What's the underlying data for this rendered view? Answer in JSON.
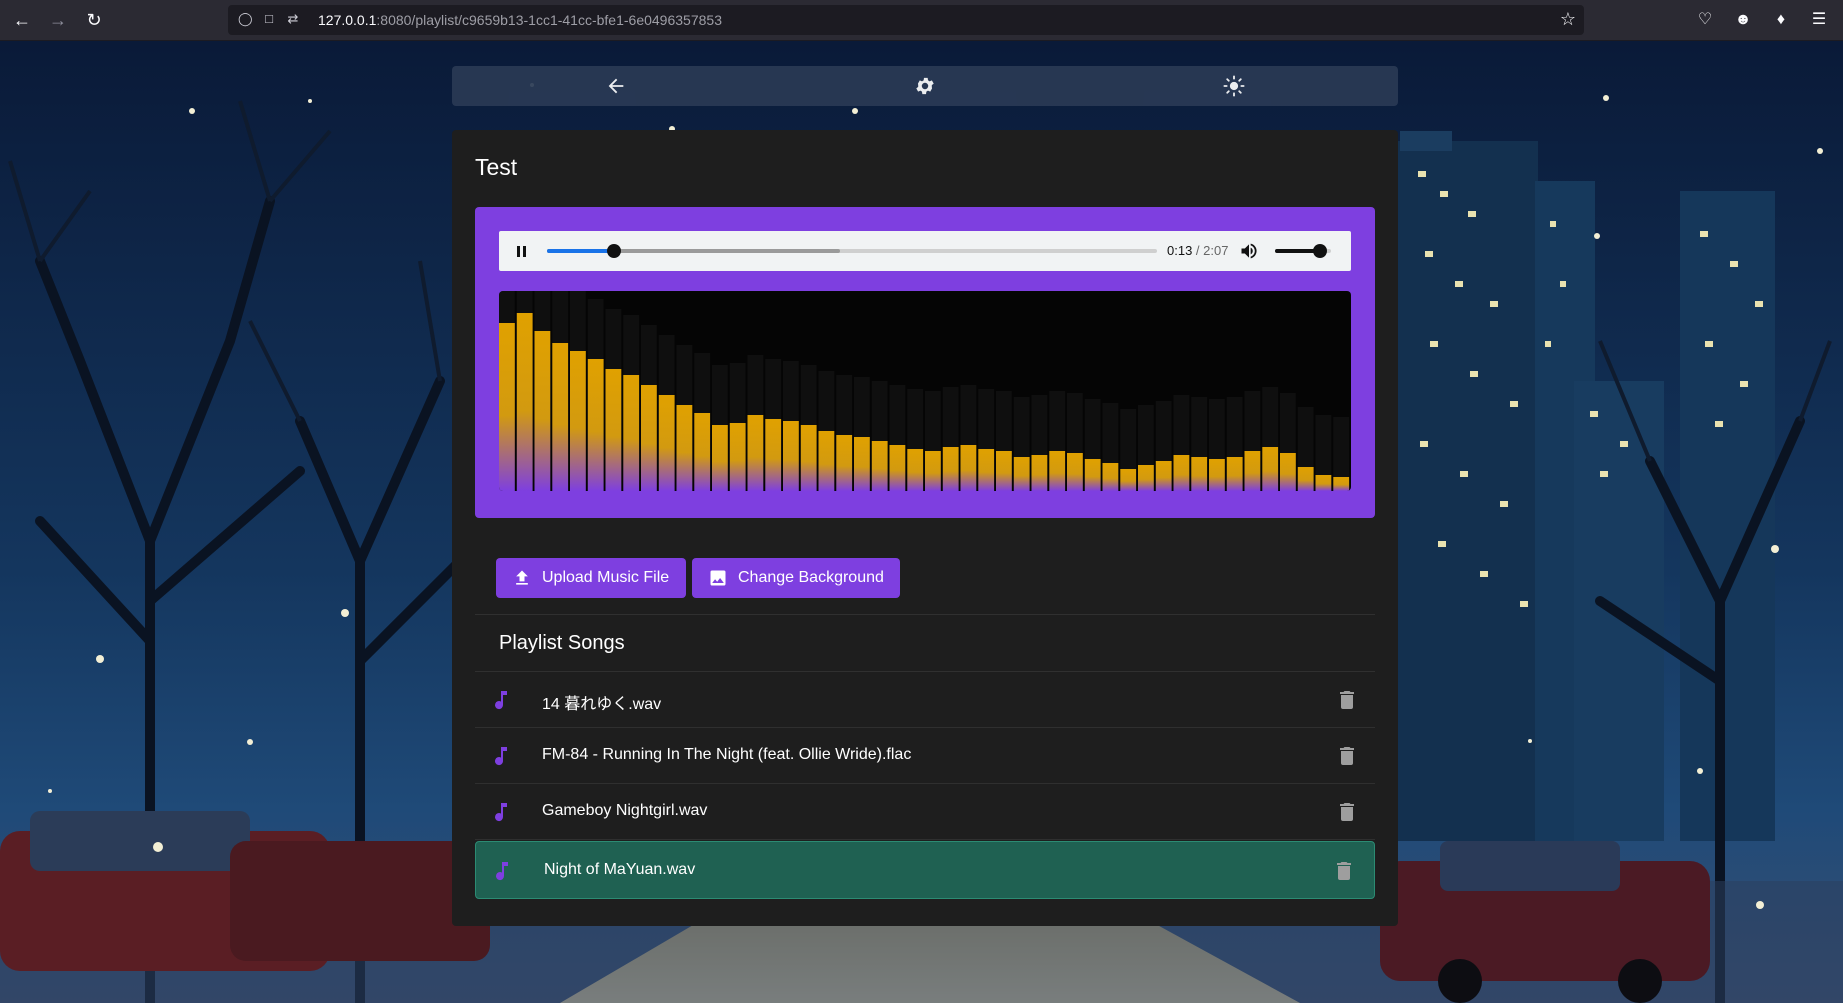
{
  "browser": {
    "url_host": "127.0.0.1",
    "url_rest": ":8080/playlist/c9659b13-1cc1-41cc-bfe1-6e0496357853"
  },
  "nav": {
    "back_icon": "arrow-back-icon",
    "settings_icon": "gear-icon",
    "theme_icon": "sun-icon"
  },
  "page": {
    "title": "Test"
  },
  "player": {
    "current_time": "0:13",
    "separator": " / ",
    "duration": "2:07",
    "progress_fraction": 0.11,
    "buffered_fraction": 0.48,
    "volume_fraction": 0.8,
    "bar_levels": [
      0.84,
      0.89,
      0.8,
      0.74,
      0.7,
      0.66,
      0.61,
      0.58,
      0.53,
      0.48,
      0.43,
      0.39,
      0.33,
      0.34,
      0.38,
      0.36,
      0.35,
      0.33,
      0.3,
      0.28,
      0.27,
      0.25,
      0.23,
      0.21,
      0.2,
      0.22,
      0.23,
      0.21,
      0.2,
      0.17,
      0.18,
      0.2,
      0.19,
      0.16,
      0.14,
      0.11,
      0.13,
      0.15,
      0.18,
      0.17,
      0.16,
      0.17,
      0.2,
      0.22,
      0.19,
      0.12,
      0.08,
      0.07
    ],
    "colors": {
      "bar_top": "#e0a100",
      "bar_bottom": "#7e3fe0",
      "panel": "#7e3fe0"
    }
  },
  "actions": {
    "upload_label": "Upload Music File",
    "background_label": "Change Background"
  },
  "playlist": {
    "heading": "Playlist Songs",
    "songs": [
      {
        "title": "14 暮れゆく.wav"
      },
      {
        "title": "FM-84 - Running In The Night (feat. Ollie Wride).flac"
      },
      {
        "title": "Gameboy Nightgirl.wav"
      },
      {
        "title": "Night of MaYuan.wav",
        "active": true
      }
    ],
    "song_icon": "music-note-icon",
    "delete_icon": "trash-icon",
    "colors": {
      "active_row": "#1f6152",
      "note": "#7e3fe0"
    }
  }
}
